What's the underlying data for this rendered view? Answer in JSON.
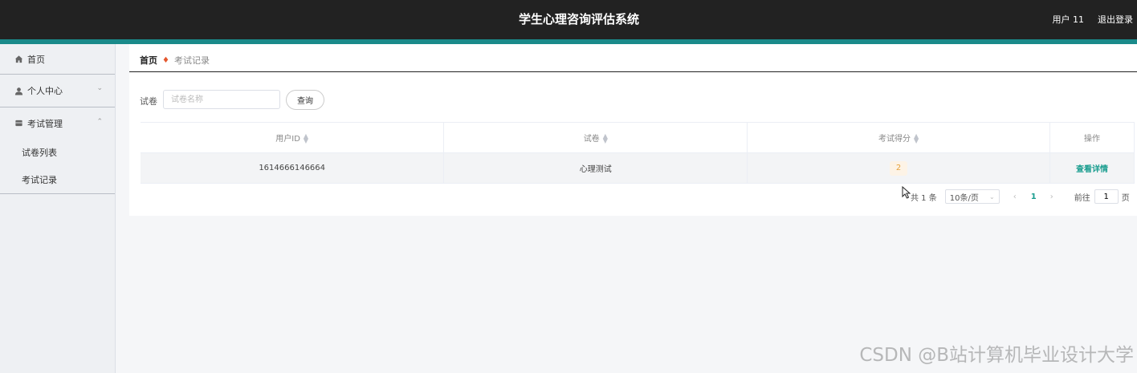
{
  "header": {
    "title": "学生心理咨询评估系统",
    "user_label": "用户 11",
    "logout_label": "退出登录"
  },
  "sidebar": {
    "items": [
      {
        "label": "首页",
        "icon": "home-icon"
      },
      {
        "label": "个人中心",
        "icon": "user-icon"
      },
      {
        "label": "考试管理",
        "icon": "exam-icon"
      }
    ],
    "sub_items": [
      "试卷列表",
      "考试记录"
    ]
  },
  "breadcrumb": {
    "home": "首页",
    "current": "考试记录"
  },
  "search": {
    "label": "试卷",
    "placeholder": "试卷名称",
    "button_label": "查询"
  },
  "table": {
    "headers": [
      "用户ID",
      "试卷",
      "考试得分",
      "操作"
    ],
    "rows": [
      {
        "user_id": "1614666146664",
        "paper": "心理测试",
        "score": "2",
        "action": "查看详情"
      }
    ]
  },
  "pagination": {
    "total": "共 1 条",
    "page_size": "10条/页",
    "current_page": "1",
    "goto_label": "前往",
    "goto_value": "1",
    "page_unit": "页"
  },
  "watermark": "CSDN @B站计算机毕业设计大学",
  "colors": {
    "topbar": "#222222",
    "accent": "#1a8a8a",
    "link": "#1a9d8f",
    "badge_bg": "#fdf3e6",
    "badge_text": "#e6a23c"
  }
}
